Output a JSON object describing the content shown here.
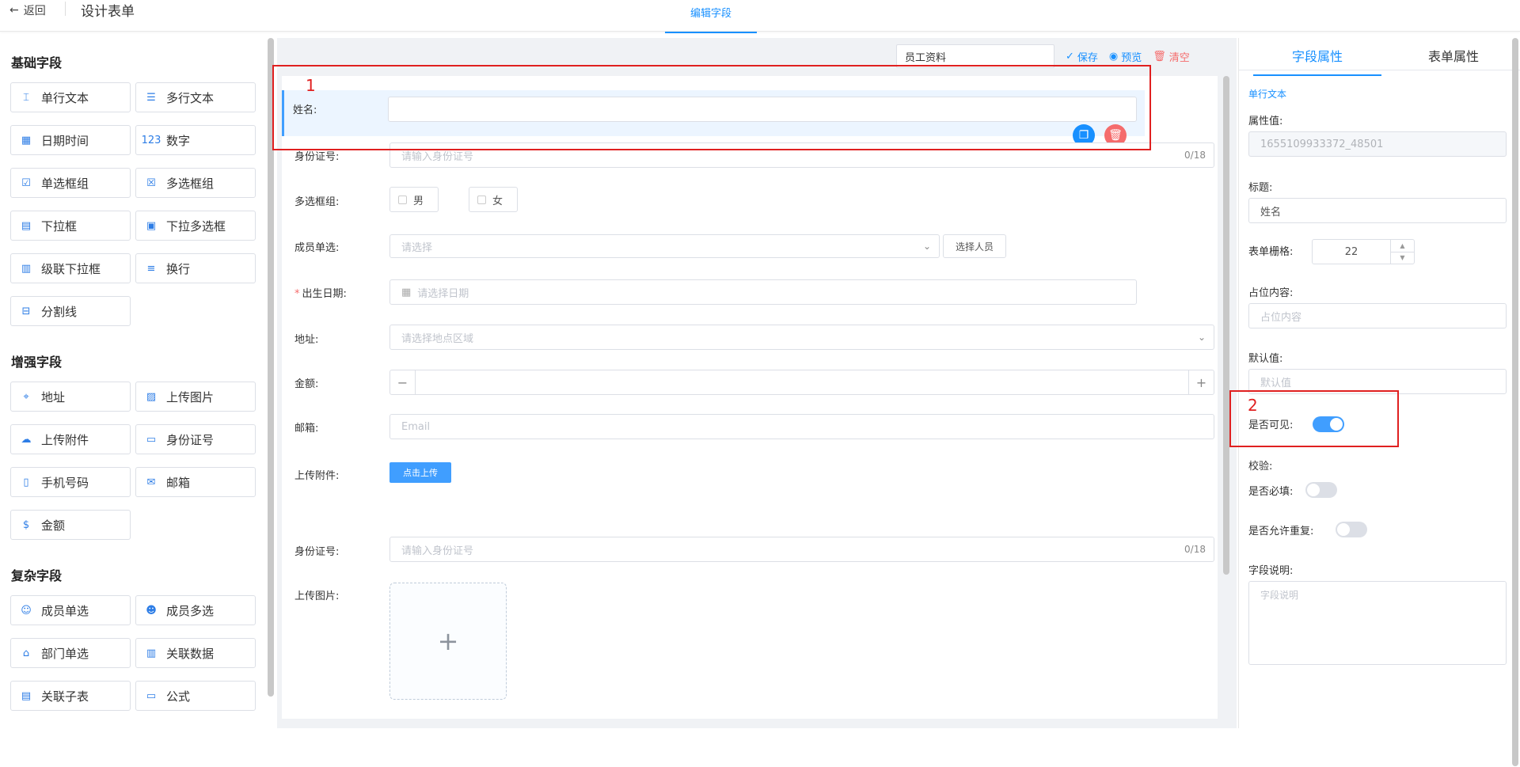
{
  "header": {
    "back_label": "返回",
    "page_title": "设计表单",
    "center_tab": "编辑字段"
  },
  "palette": {
    "basic_title": "基础字段",
    "basic": [
      {
        "label": "单行文本",
        "icon": "text-input-icon"
      },
      {
        "label": "多行文本",
        "icon": "textarea-icon"
      },
      {
        "label": "日期时间",
        "icon": "calendar-icon"
      },
      {
        "label": "数字",
        "icon": "number-icon"
      },
      {
        "label": "单选框组",
        "icon": "checkbox-icon"
      },
      {
        "label": "多选框组",
        "icon": "multi-checkbox-icon"
      },
      {
        "label": "下拉框",
        "icon": "dropdown-icon"
      },
      {
        "label": "下拉多选框",
        "icon": "dropdown-multi-icon"
      },
      {
        "label": "级联下拉框",
        "icon": "cascade-icon"
      },
      {
        "label": "换行",
        "icon": "line-break-icon"
      },
      {
        "label": "分割线",
        "icon": "divider-icon"
      }
    ],
    "enhanced_title": "增强字段",
    "enhanced": [
      {
        "label": "地址",
        "icon": "location-icon"
      },
      {
        "label": "上传图片",
        "icon": "image-icon"
      },
      {
        "label": "上传附件",
        "icon": "upload-cloud-icon"
      },
      {
        "label": "身份证号",
        "icon": "id-card-icon"
      },
      {
        "label": "手机号码",
        "icon": "phone-icon"
      },
      {
        "label": "邮箱",
        "icon": "mail-icon"
      },
      {
        "label": "金额",
        "icon": "money-bag-icon"
      }
    ],
    "complex_title": "复杂字段",
    "complex": [
      {
        "label": "成员单选",
        "icon": "user-icon"
      },
      {
        "label": "成员多选",
        "icon": "users-icon"
      },
      {
        "label": "部门单选",
        "icon": "department-icon"
      },
      {
        "label": "关联数据",
        "icon": "link-data-icon"
      },
      {
        "label": "关联子表",
        "icon": "sub-table-icon"
      },
      {
        "label": "公式",
        "icon": "formula-icon"
      }
    ]
  },
  "toolbar": {
    "form_name": "员工资料",
    "save": "保存",
    "preview": "预览",
    "clear": "清空"
  },
  "form": {
    "name_label": "姓名:",
    "id_label": "身份证号:",
    "id_placeholder": "请输入身份证号",
    "id_count": "0/18",
    "checkbox_label": "多选框组:",
    "checkbox_opt1": "男",
    "checkbox_opt2": "女",
    "member_label": "成员单选:",
    "member_placeholder": "请选择",
    "member_button": "选择人员",
    "birth_label": "出生日期:",
    "birth_required": "*",
    "birth_placeholder": "请选择日期",
    "address_label": "地址:",
    "address_placeholder": "请选择地点区域",
    "amount_label": "金额:",
    "amount_minus": "−",
    "amount_plus": "+",
    "email_label": "邮箱:",
    "email_placeholder": "Email",
    "attach_label": "上传附件:",
    "attach_button": "点击上传",
    "id2_label": "身份证号:",
    "id2_placeholder": "请输入身份证号",
    "id2_count": "0/18",
    "image_label": "上传图片:",
    "image_plus": "+"
  },
  "properties": {
    "tab_field": "字段属性",
    "tab_form": "表单属性",
    "field_type": "单行文本",
    "attr_value_label": "属性值:",
    "attr_value": "1655109933372_48501",
    "title_label": "标题:",
    "title_value": "姓名",
    "grid_label": "表单栅格:",
    "grid_value": "22",
    "placeholder_label": "占位内容:",
    "placeholder_placeholder": "占位内容",
    "default_label": "默认值:",
    "default_placeholder": "默认值",
    "visible_label": "是否可见:",
    "visible_on": true,
    "validate_label": "校验:",
    "required_label": "是否必填:",
    "required_on": false,
    "duplicate_label": "是否允许重复:",
    "duplicate_on": false,
    "desc_label": "字段说明:",
    "desc_placeholder": "字段说明"
  },
  "annotations": {
    "box1_num": "1",
    "box2_num": "2"
  },
  "colors": {
    "primary": "#409eff",
    "danger": "#f56c6c",
    "annotation": "#e02020"
  }
}
